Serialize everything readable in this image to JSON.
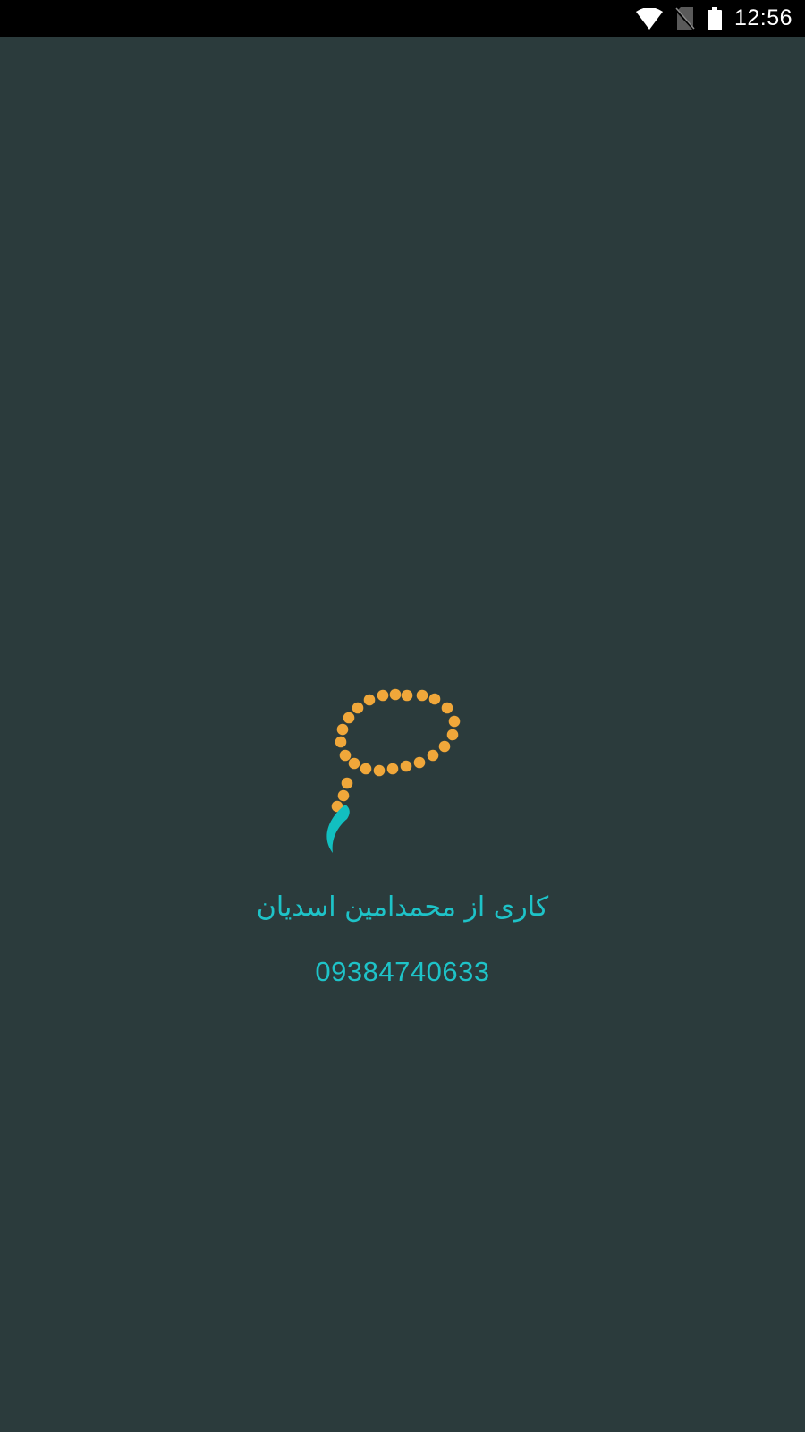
{
  "status_bar": {
    "time": "12:56",
    "icons": [
      "wifi-icon",
      "no-sim-icon",
      "battery-icon"
    ]
  },
  "splash": {
    "logo_icon": "prayer-beads-icon",
    "credit_text": "کاری از محمدامین اسدیان",
    "phone_number": "09384740633"
  },
  "colors": {
    "background": "#2b3b3c",
    "status_bar": "#000000",
    "accent_text": "#1ec3c8",
    "beads": "#f0a73a",
    "tassel": "#12bfc0"
  }
}
